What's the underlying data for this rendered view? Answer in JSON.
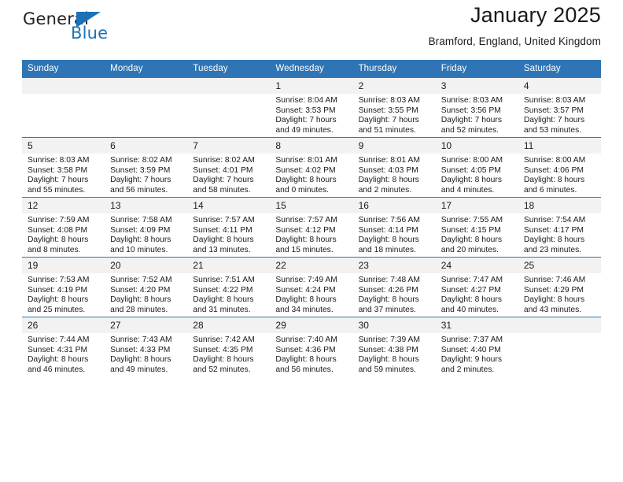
{
  "brand": {
    "name_part1": "General",
    "name_part2": "Blue",
    "triangle_color": "#1b72b8"
  },
  "header": {
    "title": "January 2025",
    "subtitle": "Bramford, England, United Kingdom"
  },
  "theme": {
    "header_blue": "#2f75b5",
    "daynum_gray": "#f2f2f2",
    "text": "#1a1a1a"
  },
  "calendar": {
    "weekday_headers": [
      "Sunday",
      "Monday",
      "Tuesday",
      "Wednesday",
      "Thursday",
      "Friday",
      "Saturday"
    ],
    "weeks": [
      [
        {
          "day": "",
          "lines": []
        },
        {
          "day": "",
          "lines": []
        },
        {
          "day": "",
          "lines": []
        },
        {
          "day": "1",
          "lines": [
            "Sunrise: 8:04 AM",
            "Sunset: 3:53 PM",
            "Daylight: 7 hours",
            "and 49 minutes."
          ]
        },
        {
          "day": "2",
          "lines": [
            "Sunrise: 8:03 AM",
            "Sunset: 3:55 PM",
            "Daylight: 7 hours",
            "and 51 minutes."
          ]
        },
        {
          "day": "3",
          "lines": [
            "Sunrise: 8:03 AM",
            "Sunset: 3:56 PM",
            "Daylight: 7 hours",
            "and 52 minutes."
          ]
        },
        {
          "day": "4",
          "lines": [
            "Sunrise: 8:03 AM",
            "Sunset: 3:57 PM",
            "Daylight: 7 hours",
            "and 53 minutes."
          ]
        }
      ],
      [
        {
          "day": "5",
          "lines": [
            "Sunrise: 8:03 AM",
            "Sunset: 3:58 PM",
            "Daylight: 7 hours",
            "and 55 minutes."
          ]
        },
        {
          "day": "6",
          "lines": [
            "Sunrise: 8:02 AM",
            "Sunset: 3:59 PM",
            "Daylight: 7 hours",
            "and 56 minutes."
          ]
        },
        {
          "day": "7",
          "lines": [
            "Sunrise: 8:02 AM",
            "Sunset: 4:01 PM",
            "Daylight: 7 hours",
            "and 58 minutes."
          ]
        },
        {
          "day": "8",
          "lines": [
            "Sunrise: 8:01 AM",
            "Sunset: 4:02 PM",
            "Daylight: 8 hours",
            "and 0 minutes."
          ]
        },
        {
          "day": "9",
          "lines": [
            "Sunrise: 8:01 AM",
            "Sunset: 4:03 PM",
            "Daylight: 8 hours",
            "and 2 minutes."
          ]
        },
        {
          "day": "10",
          "lines": [
            "Sunrise: 8:00 AM",
            "Sunset: 4:05 PM",
            "Daylight: 8 hours",
            "and 4 minutes."
          ]
        },
        {
          "day": "11",
          "lines": [
            "Sunrise: 8:00 AM",
            "Sunset: 4:06 PM",
            "Daylight: 8 hours",
            "and 6 minutes."
          ]
        }
      ],
      [
        {
          "day": "12",
          "lines": [
            "Sunrise: 7:59 AM",
            "Sunset: 4:08 PM",
            "Daylight: 8 hours",
            "and 8 minutes."
          ]
        },
        {
          "day": "13",
          "lines": [
            "Sunrise: 7:58 AM",
            "Sunset: 4:09 PM",
            "Daylight: 8 hours",
            "and 10 minutes."
          ]
        },
        {
          "day": "14",
          "lines": [
            "Sunrise: 7:57 AM",
            "Sunset: 4:11 PM",
            "Daylight: 8 hours",
            "and 13 minutes."
          ]
        },
        {
          "day": "15",
          "lines": [
            "Sunrise: 7:57 AM",
            "Sunset: 4:12 PM",
            "Daylight: 8 hours",
            "and 15 minutes."
          ]
        },
        {
          "day": "16",
          "lines": [
            "Sunrise: 7:56 AM",
            "Sunset: 4:14 PM",
            "Daylight: 8 hours",
            "and 18 minutes."
          ]
        },
        {
          "day": "17",
          "lines": [
            "Sunrise: 7:55 AM",
            "Sunset: 4:15 PM",
            "Daylight: 8 hours",
            "and 20 minutes."
          ]
        },
        {
          "day": "18",
          "lines": [
            "Sunrise: 7:54 AM",
            "Sunset: 4:17 PM",
            "Daylight: 8 hours",
            "and 23 minutes."
          ]
        }
      ],
      [
        {
          "day": "19",
          "lines": [
            "Sunrise: 7:53 AM",
            "Sunset: 4:19 PM",
            "Daylight: 8 hours",
            "and 25 minutes."
          ]
        },
        {
          "day": "20",
          "lines": [
            "Sunrise: 7:52 AM",
            "Sunset: 4:20 PM",
            "Daylight: 8 hours",
            "and 28 minutes."
          ]
        },
        {
          "day": "21",
          "lines": [
            "Sunrise: 7:51 AM",
            "Sunset: 4:22 PM",
            "Daylight: 8 hours",
            "and 31 minutes."
          ]
        },
        {
          "day": "22",
          "lines": [
            "Sunrise: 7:49 AM",
            "Sunset: 4:24 PM",
            "Daylight: 8 hours",
            "and 34 minutes."
          ]
        },
        {
          "day": "23",
          "lines": [
            "Sunrise: 7:48 AM",
            "Sunset: 4:26 PM",
            "Daylight: 8 hours",
            "and 37 minutes."
          ]
        },
        {
          "day": "24",
          "lines": [
            "Sunrise: 7:47 AM",
            "Sunset: 4:27 PM",
            "Daylight: 8 hours",
            "and 40 minutes."
          ]
        },
        {
          "day": "25",
          "lines": [
            "Sunrise: 7:46 AM",
            "Sunset: 4:29 PM",
            "Daylight: 8 hours",
            "and 43 minutes."
          ]
        }
      ],
      [
        {
          "day": "26",
          "lines": [
            "Sunrise: 7:44 AM",
            "Sunset: 4:31 PM",
            "Daylight: 8 hours",
            "and 46 minutes."
          ]
        },
        {
          "day": "27",
          "lines": [
            "Sunrise: 7:43 AM",
            "Sunset: 4:33 PM",
            "Daylight: 8 hours",
            "and 49 minutes."
          ]
        },
        {
          "day": "28",
          "lines": [
            "Sunrise: 7:42 AM",
            "Sunset: 4:35 PM",
            "Daylight: 8 hours",
            "and 52 minutes."
          ]
        },
        {
          "day": "29",
          "lines": [
            "Sunrise: 7:40 AM",
            "Sunset: 4:36 PM",
            "Daylight: 8 hours",
            "and 56 minutes."
          ]
        },
        {
          "day": "30",
          "lines": [
            "Sunrise: 7:39 AM",
            "Sunset: 4:38 PM",
            "Daylight: 8 hours",
            "and 59 minutes."
          ]
        },
        {
          "day": "31",
          "lines": [
            "Sunrise: 7:37 AM",
            "Sunset: 4:40 PM",
            "Daylight: 9 hours",
            "and 2 minutes."
          ]
        },
        {
          "day": "",
          "lines": []
        }
      ]
    ]
  }
}
